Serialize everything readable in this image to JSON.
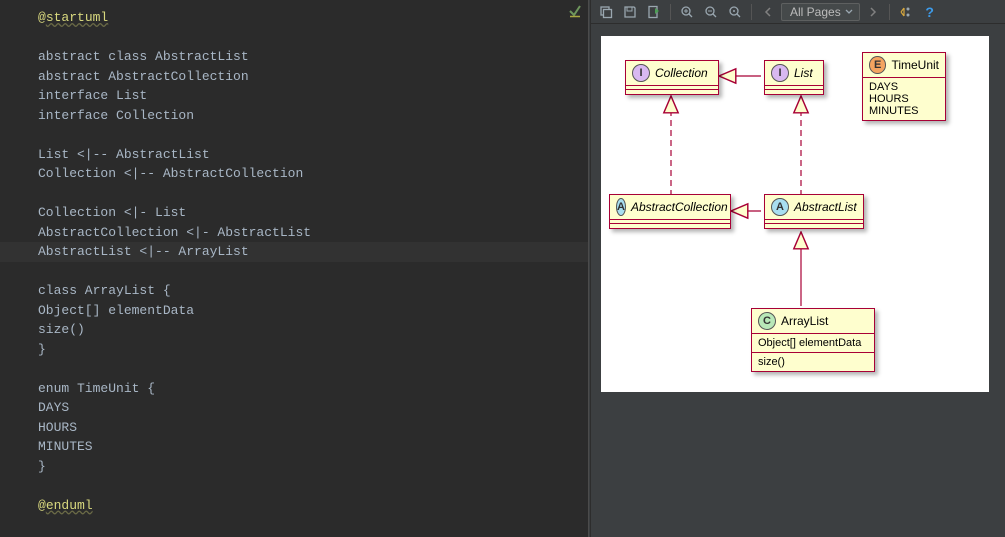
{
  "editor": {
    "startuml_at": "@",
    "startuml": "startuml",
    "l1": "abstract class AbstractList",
    "l2": "abstract AbstractCollection",
    "l3": "interface List",
    "l4": "interface Collection",
    "l5": "List <|-- AbstractList",
    "l6": "Collection <|-- AbstractCollection",
    "l7": "Collection <|- List",
    "l8": "AbstractCollection <|- AbstractList",
    "l9": "AbstractList <|-- ArrayList",
    "l10": "class ArrayList {",
    "l11": "Object[] elementData",
    "l12": "size()",
    "l13": "}",
    "l14": "enum TimeUnit {",
    "l15": "DAYS",
    "l16": "HOURS",
    "l17": "MINUTES",
    "l18": "}",
    "enduml_at": "@",
    "enduml": "enduml"
  },
  "toolbar": {
    "page_label": "All Pages"
  },
  "uml": {
    "collection": "Collection",
    "list": "List",
    "abstractcollection": "AbstractCollection",
    "abstractlist": "AbstractList",
    "arraylist": "ArrayList",
    "arraylist_m1": "Object[] elementData",
    "arraylist_m2": "size()",
    "timeunit": "TimeUnit",
    "tu1": "DAYS",
    "tu2": "HOURS",
    "tu3": "MINUTES",
    "stereo_i": "I",
    "stereo_a": "A",
    "stereo_c": "C",
    "stereo_e": "E"
  }
}
